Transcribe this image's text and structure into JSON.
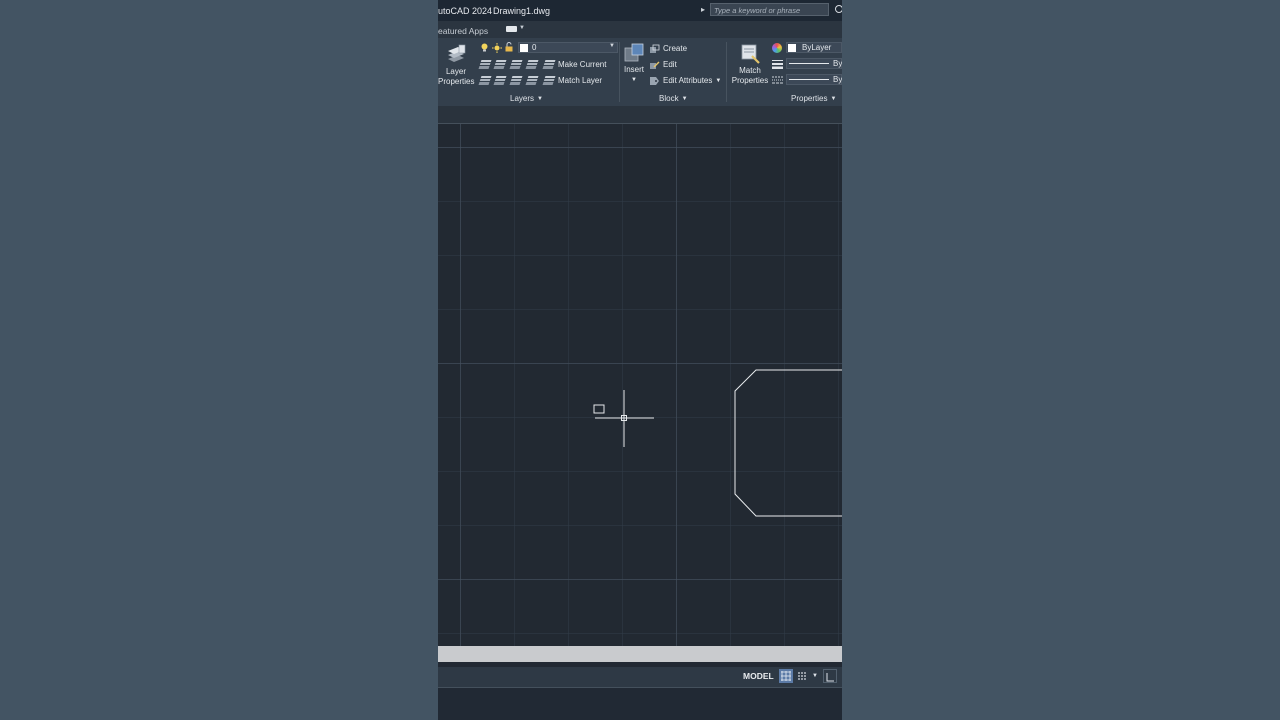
{
  "titlebar": {
    "app_title": "utoCAD 2024",
    "doc_title": "Drawing1.dwg",
    "search_placeholder": "Type a keyword or phrase"
  },
  "tabrow": {
    "featured_apps": "eatured Apps"
  },
  "ribbon": {
    "layers": {
      "big_button_line1": "Layer",
      "big_button_line2": "Properties",
      "layer_value": "0",
      "make_current": "Make Current",
      "match_layer": "Match Layer",
      "panel_title": "Layers"
    },
    "block": {
      "insert": "Insert",
      "create": "Create",
      "edit": "Edit",
      "edit_attributes": "Edit Attributes",
      "panel_title": "Block"
    },
    "properties": {
      "big_button_line1": "Match",
      "big_button_line2": "Properties",
      "color_value": "ByLayer",
      "linetype_value": "By",
      "lineweight_value": "By",
      "panel_title": "Properties"
    }
  },
  "statusbar": {
    "model_tab": "MODEL"
  },
  "colors": {
    "background": "#435463",
    "canvas": "#222932",
    "ribbon": "#333f4c",
    "command_line": "#c9cbce"
  }
}
